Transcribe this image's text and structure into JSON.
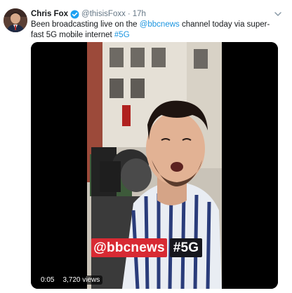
{
  "tweet": {
    "author_name": "Chris Fox",
    "handle": "@thisisFoxx",
    "separator": "·",
    "time": "17h",
    "text_before": "Been broadcasting live on the ",
    "mention": "@bbcnews",
    "text_after": " channel today via super-fast 5G mobile internet ",
    "hashtag": "#5G",
    "icons": {
      "verified": "verified-badge-icon",
      "menu": "chevron-down-icon"
    }
  },
  "video": {
    "overlay_badge_bbc": "@bbcnews",
    "overlay_badge_5g": "#5G",
    "elapsed": "0:05",
    "views": "3,720 views"
  },
  "colors": {
    "link": "#1b95e0",
    "verified": "#1da1f2",
    "bbc_badge": "#d82a33",
    "fiveg_badge": "#16161d"
  }
}
